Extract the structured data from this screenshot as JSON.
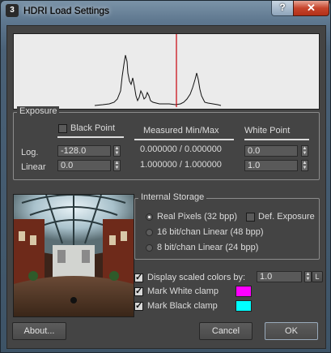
{
  "window": {
    "title": "HDRI Load Settings",
    "app_icon": "3",
    "help_label": "?",
    "close_label": "✕"
  },
  "exposure": {
    "group_label": "Exposure",
    "black_point_label": "Black Point",
    "black_point_checked": false,
    "measured_header": "Measured Min/Max",
    "white_point_header": "White Point",
    "log_label": "Log.",
    "linear_label": "Linear",
    "black_log": "-128.0",
    "black_linear": "0.0",
    "measured_log": "0.000000 / 0.000000",
    "measured_linear": "1.000000 / 1.000000",
    "white_log": "0.0",
    "white_linear": "1.0"
  },
  "storage": {
    "group_label": "Internal Storage",
    "options": [
      "Real Pixels (32 bpp)",
      "16 bit/chan Linear (48 bpp)",
      "8 bit/chan Linear (24 bpp)"
    ],
    "selected_index": 0,
    "def_exposure_label": "Def. Exposure",
    "def_exposure_checked": false
  },
  "display": {
    "scaled_label": "Display scaled colors by:",
    "scaled_checked": true,
    "scaled_value": "1.0",
    "lock_label": "L",
    "white_clamp_label": "Mark White clamp",
    "white_clamp_checked": true,
    "white_clamp_color": "#ff00ff",
    "black_clamp_label": "Mark Black clamp",
    "black_clamp_checked": true,
    "black_clamp_color": "#00ffff"
  },
  "buttons": {
    "about": "About...",
    "cancel": "Cancel",
    "ok": "OK"
  },
  "colors": {
    "histogram_marker": "#c8000a",
    "histogram_bg": "#ebebeb",
    "dialog_bg": "#444444"
  }
}
